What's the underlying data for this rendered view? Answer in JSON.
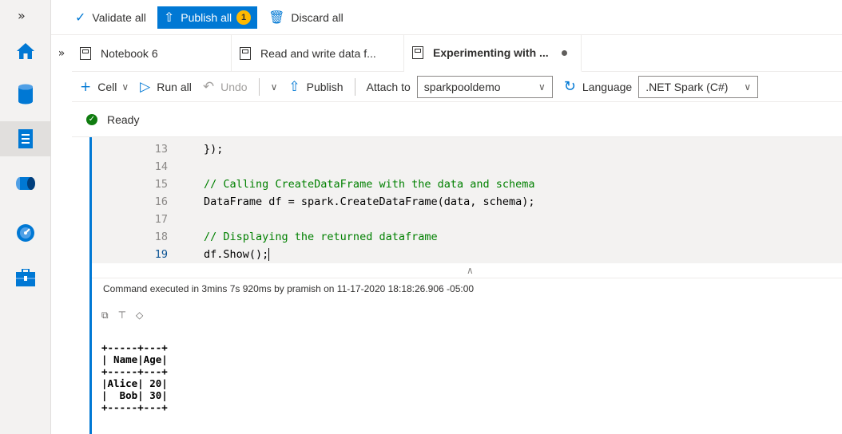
{
  "rail": {
    "expand_glyph": "»",
    "items": [
      {
        "name": "home-icon",
        "color": "#0078d4"
      },
      {
        "name": "data-icon",
        "color": "#0078d4"
      },
      {
        "name": "develop-icon",
        "color": "#0078d4"
      },
      {
        "name": "integrate-icon",
        "color": "#0078d4"
      },
      {
        "name": "monitor-icon",
        "color": "#0078d4"
      },
      {
        "name": "manage-icon",
        "color": "#0078d4"
      }
    ]
  },
  "topbar": {
    "validate_label": "Validate all",
    "publish_label": "Publish all",
    "publish_badge": "1",
    "discard_label": "Discard all"
  },
  "tabs": {
    "expand_glyph": "»",
    "items": [
      {
        "label": "Notebook 6"
      },
      {
        "label": "Read and write data f..."
      },
      {
        "label": "Experimenting with ..."
      }
    ]
  },
  "toolbar": {
    "cell_label": "Cell",
    "run_all_label": "Run all",
    "undo_label": "Undo",
    "publish_label": "Publish",
    "attach_label": "Attach to",
    "attach_value": "sparkpooldemo",
    "language_label": "Language",
    "language_value": ".NET Spark (C#)"
  },
  "status": {
    "text": "Ready"
  },
  "code": {
    "lines": [
      {
        "n": "13",
        "text": "});",
        "comment": false
      },
      {
        "n": "14",
        "text": "",
        "comment": false
      },
      {
        "n": "15",
        "text": "// Calling CreateDataFrame with the data and schema",
        "comment": true
      },
      {
        "n": "16",
        "text": "DataFrame df = spark.CreateDataFrame(data, schema);",
        "comment": false
      },
      {
        "n": "17",
        "text": "",
        "comment": false
      },
      {
        "n": "18",
        "text": "// Displaying the returned dataframe",
        "comment": true
      },
      {
        "n": "19",
        "text": "df.Show();",
        "comment": false
      }
    ]
  },
  "execution": {
    "text": "Command executed in 3mins 7s 920ms by pramish on 11-17-2020 18:18:26.906 -05:00"
  },
  "output": {
    "text": "+-----+---+\n| Name|Age|\n+-----+---+\n|Alice| 20|\n|  Bob| 30|\n+-----+---+"
  },
  "colors": {
    "accent": "#0078d4",
    "badge": "#ffb900",
    "ready": "#107c10",
    "comment": "#008000"
  }
}
